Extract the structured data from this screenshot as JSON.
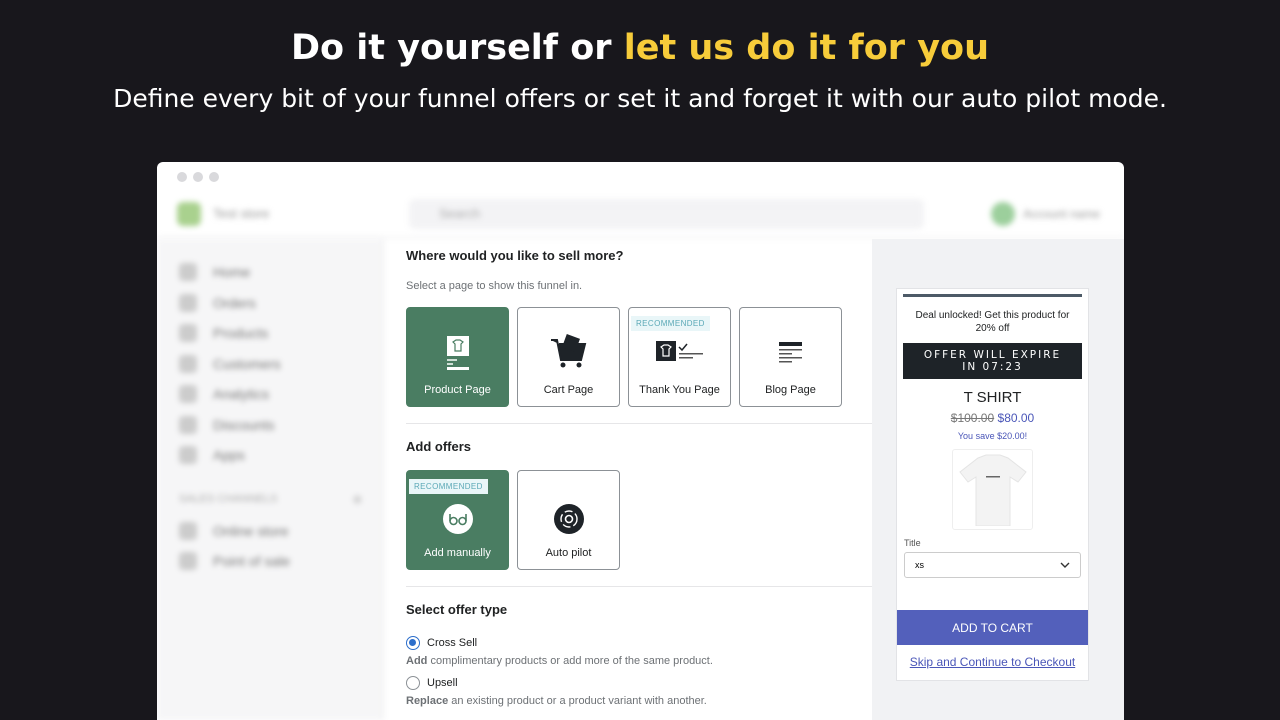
{
  "hero": {
    "title_part1": "Do it yourself or ",
    "title_highlight": "let us do it for you",
    "subtitle": "Define every bit of your funnel offers or set it and forget it with our auto pilot mode."
  },
  "colors": {
    "highlight": "#f7cc3a",
    "selected_card": "#4a7d62",
    "accent": "#5360bb"
  },
  "topbar": {
    "store_name": "Test store",
    "search_placeholder": "Search",
    "user_name": "Account name"
  },
  "sidebar": {
    "items": [
      {
        "label": "Home"
      },
      {
        "label": "Orders"
      },
      {
        "label": "Products"
      },
      {
        "label": "Customers"
      },
      {
        "label": "Analytics"
      },
      {
        "label": "Discounts"
      },
      {
        "label": "Apps"
      }
    ],
    "section_label": "SALES CHANNELS",
    "channels": [
      {
        "label": "Online store"
      },
      {
        "label": "Point of sale"
      }
    ]
  },
  "main": {
    "sell_title": "Where would you like to sell more?",
    "sell_sub": "Select a page to show this funnel in.",
    "pages": [
      {
        "label": "Product Page",
        "icon": "product-page-icon",
        "selected": true
      },
      {
        "label": "Cart Page",
        "icon": "cart-icon"
      },
      {
        "label": "Thank You Page",
        "icon": "thank-you-icon",
        "badge": "RECOMMENDED"
      },
      {
        "label": "Blog Page",
        "icon": "blog-icon"
      }
    ],
    "offers_title": "Add offers",
    "offers": [
      {
        "label": "Add manually",
        "icon": "glasses-icon",
        "selected": true,
        "badge": "RECOMMENDED"
      },
      {
        "label": "Auto pilot",
        "icon": "autopilot-icon"
      }
    ],
    "type_title": "Select offer type",
    "types": [
      {
        "label": "Cross Sell",
        "checked": true,
        "desc_bold": "Add",
        "desc": " complimentary products or add more of the same product."
      },
      {
        "label": "Upsell",
        "checked": false,
        "desc_bold": "Replace",
        "desc": " an existing product or a product variant with another."
      }
    ]
  },
  "preview": {
    "deal": "Deal unlocked! Get this product for 20% off",
    "timer_line1": "OFFER WILL EXPIRE",
    "timer_line2": "IN 07:23",
    "product": "T SHIRT",
    "old_price": "$100.00",
    "new_price": "$80.00",
    "save": "You save $20.00!",
    "select_label": "Title",
    "select_value": "xs",
    "add_to_cart": "ADD TO CART",
    "skip": "Skip and Continue to Checkout"
  }
}
